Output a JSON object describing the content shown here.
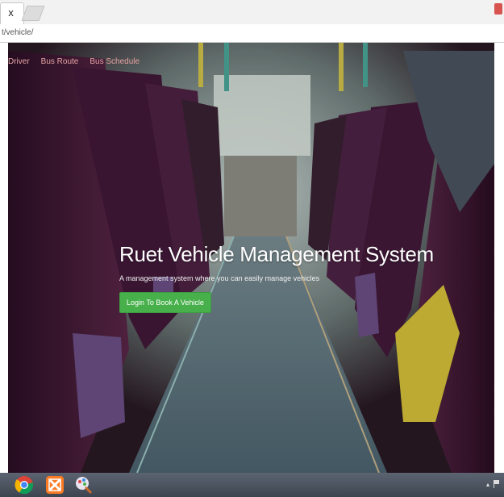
{
  "browser": {
    "tab_close": "x",
    "url": "t/vehicle/"
  },
  "nav": {
    "items": [
      {
        "label": "Driver"
      },
      {
        "label": "Bus Route"
      },
      {
        "label": "Bus Schedule"
      }
    ]
  },
  "hero": {
    "title": "Ruet Vehicle Management System",
    "subtitle": "A management system where you can easily manage vehicles",
    "login_button": "Login To Book A Vehicle"
  },
  "taskbar": {
    "apps": [
      "chrome-icon",
      "xampp-icon",
      "paint-icon"
    ],
    "tray": "tray-show-hidden-icons"
  },
  "colors": {
    "button": "#47b04b",
    "nav_link": "#e7a3a3",
    "seat": "#4a1f3d",
    "taskbar": "#4a525d"
  }
}
